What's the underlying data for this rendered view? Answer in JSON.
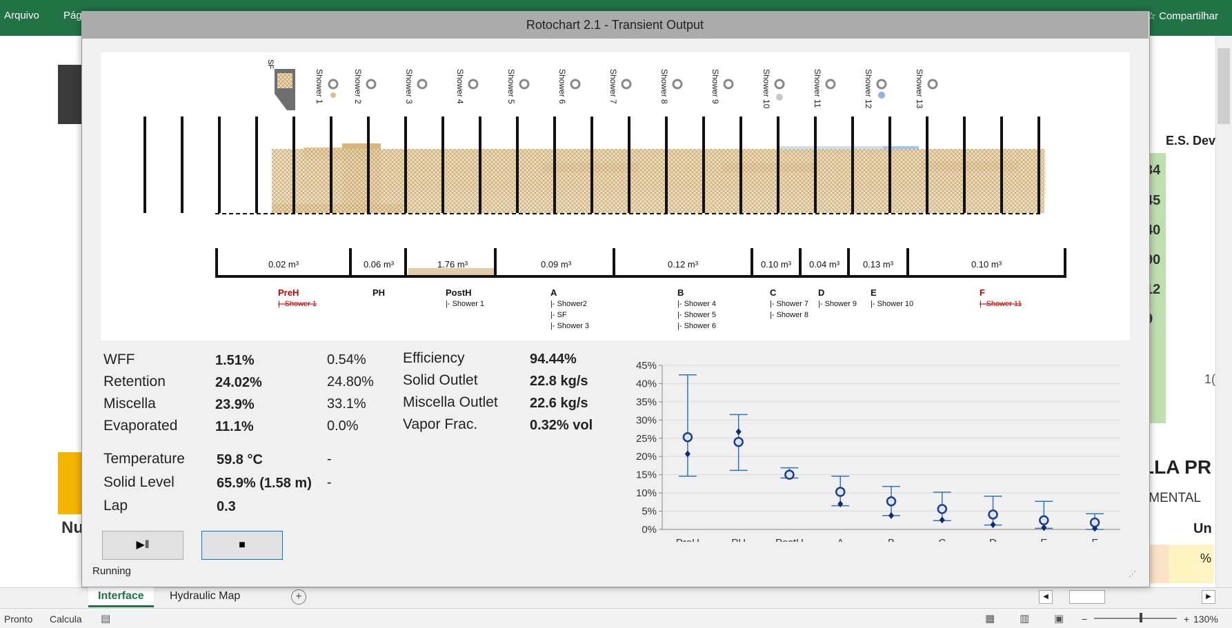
{
  "excel": {
    "ribbon_tabs": [
      "Arquivo",
      "Pág"
    ],
    "share_label": "Compartilhar",
    "background": {
      "column_header": "E.S. Dev",
      "green_numbers": [
        "34",
        "45",
        "40",
        "90",
        "12",
        "9"
      ],
      "ten_text": "1(",
      "nu_text": "Nu",
      "lla_text": "LLA PR",
      "imental_text": "IMENTAL",
      "un_text": "Un",
      "pct_text": "%"
    },
    "sheet_tabs": [
      "Interface",
      "Hydraulic Map"
    ],
    "status": {
      "ready": "Pronto",
      "calc": "Calcula",
      "zoom": "130%"
    }
  },
  "dialog": {
    "title": "Rotochart 2.1 - Transient Output",
    "status": "Running",
    "sf_label": "SF",
    "showers": [
      "Shower 1",
      "Shower 2",
      "Shower 3",
      "Shower 4",
      "Shower 5",
      "Shower 6",
      "Shower 7",
      "Shower 8",
      "Shower 9",
      "Shower 10",
      "Shower 11",
      "Shower 12",
      "Shower 13"
    ],
    "volumes": [
      "0.02 m³",
      "0.06 m³",
      "1.76 m³",
      "0.09 m³",
      "0.12 m³",
      "0.10 m³",
      "0.04 m³",
      "0.13 m³",
      "0.10 m³"
    ],
    "sections": [
      {
        "name": "PreH",
        "sub": [
          "|- Shower 1"
        ]
      },
      {
        "name": "PH",
        "sub": []
      },
      {
        "name": "PostH",
        "sub": [
          "|- Shower 1"
        ]
      },
      {
        "name": "A",
        "sub": [
          "|- Shower2",
          "|- SF",
          "|- Shower 3"
        ]
      },
      {
        "name": "B",
        "sub": [
          "|- Shower 4",
          "|- Shower 5",
          "|- Shower 6"
        ]
      },
      {
        "name": "C",
        "sub": [
          "|- Shower 7",
          "|- Shower 8"
        ]
      },
      {
        "name": "D",
        "sub": [
          "|- Shower 9"
        ]
      },
      {
        "name": "E",
        "sub": [
          "|- Shower 10"
        ]
      },
      {
        "name": "F",
        "sub": [
          "|- Shower 11"
        ]
      }
    ],
    "stats": {
      "wff": {
        "label": "WFF",
        "value": "1.51%",
        "ref": "0.54%"
      },
      "retention": {
        "label": "Retention",
        "value": "24.02%",
        "ref": "24.80%"
      },
      "miscella": {
        "label": "Miscella",
        "value": "23.9%",
        "ref": "33.1%"
      },
      "evaporated": {
        "label": "Evaporated",
        "value": "11.1%",
        "ref": "0.0%"
      },
      "temperature": {
        "label": "Temperature",
        "value": "59.8 °C",
        "ref": "-"
      },
      "solid_level": {
        "label": "Solid Level",
        "value": "65.9% (1.58 m)",
        "ref": "-"
      },
      "lap": {
        "label": "Lap",
        "value": "0.3"
      },
      "efficiency": {
        "label": "Efficiency",
        "value": "94.44%"
      },
      "solid_outlet": {
        "label": "Solid Outlet",
        "value": "22.8 kg/s"
      },
      "miscella_outlet": {
        "label": "Miscella Outlet",
        "value": "22.6 kg/s"
      },
      "vapor_frac": {
        "label": "Vapor Frac.",
        "value": "0.32% vol"
      }
    },
    "buttons": {
      "play_pause": "▶‖",
      "stop": "■"
    }
  },
  "chart_data": {
    "type": "scatter",
    "categories": [
      "PreH",
      "PH",
      "PostH",
      "A",
      "B",
      "C",
      "D",
      "E",
      "F"
    ],
    "y_ticks": [
      "0%",
      "5%",
      "10%",
      "15%",
      "20%",
      "25%",
      "30%",
      "35%",
      "40%",
      "45%"
    ],
    "ylim": [
      0,
      45
    ],
    "grid": true,
    "series": [
      {
        "marker": "circle",
        "values": [
          25.3,
          24.0,
          15.0,
          10.3,
          7.7,
          5.6,
          4.1,
          2.5,
          1.9
        ]
      },
      {
        "marker": "diamond",
        "values": [
          20.7,
          26.8,
          15.1,
          7.0,
          3.8,
          2.6,
          1.3,
          0.5,
          0.3
        ]
      }
    ],
    "error_bars": {
      "low": [
        14.6,
        16.2,
        14.1,
        6.5,
        3.8,
        2.4,
        1.2,
        0.3,
        0.0
      ],
      "high": [
        42.4,
        31.5,
        16.9,
        14.6,
        11.8,
        10.2,
        9.1,
        7.7,
        4.3
      ]
    },
    "colors": {
      "circle": "#1f3c8a",
      "diamond": "#0f2a6e",
      "error": "#2e75b6",
      "grid": "#d9d9d9"
    }
  }
}
